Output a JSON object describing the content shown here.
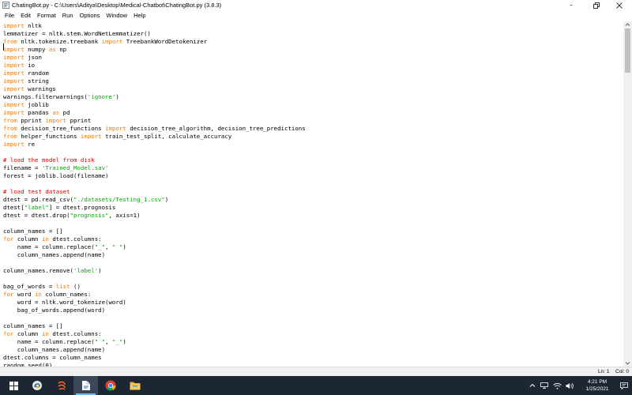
{
  "window": {
    "title": "ChatingBot.py - C:\\Users\\Aditya\\Desktop\\Medical-Chatbot\\ChatingBot.py (3.8.3)",
    "app_icon": "idle-python-icon",
    "minimize_label": "–",
    "controls": [
      "minimize-icon",
      "restore-icon",
      "close-icon"
    ]
  },
  "menu": {
    "items": [
      "File",
      "Edit",
      "Format",
      "Run",
      "Options",
      "Window",
      "Help"
    ]
  },
  "colors": {
    "keyword": "#ff7700",
    "string": "#00aa00",
    "comment": "#dd0000",
    "taskbar": "#1d2733"
  },
  "editor": {
    "lines": [
      [
        [
          "kw",
          "import"
        ],
        [
          "",
          "nltk"
        ]
      ],
      [
        [
          "",
          "lemmatizer = nltk.stem.WordNetLemmatizer()"
        ]
      ],
      [
        [
          "kw",
          "from"
        ],
        [
          "",
          "nltk.tokenize.treebank "
        ],
        [
          "kw",
          "import"
        ],
        [
          "",
          "TreebankWordDetokenizer"
        ]
      ],
      [
        [
          "kw",
          "import"
        ],
        [
          "",
          "numpy "
        ],
        [
          "kw",
          "as"
        ],
        [
          "",
          "np"
        ]
      ],
      [
        [
          "kw",
          "import"
        ],
        [
          "",
          "json"
        ]
      ],
      [
        [
          "kw",
          "import"
        ],
        [
          "",
          "io"
        ]
      ],
      [
        [
          "kw",
          "import"
        ],
        [
          "",
          "random"
        ]
      ],
      [
        [
          "kw",
          "import"
        ],
        [
          "",
          "string"
        ]
      ],
      [
        [
          "kw",
          "import"
        ],
        [
          "",
          "warnings"
        ]
      ],
      [
        [
          "",
          "warnings.filterwarnings("
        ],
        [
          "str",
          "'ignore'"
        ],
        [
          "",
          ")"
        ]
      ],
      [
        [
          "kw",
          "import"
        ],
        [
          "",
          "joblib"
        ]
      ],
      [
        [
          "kw",
          "import"
        ],
        [
          "",
          "pandas "
        ],
        [
          "kw",
          "as"
        ],
        [
          "",
          "pd"
        ]
      ],
      [
        [
          "kw",
          "from"
        ],
        [
          "",
          "pprint "
        ],
        [
          "kw",
          "import"
        ],
        [
          "",
          "pprint"
        ]
      ],
      [
        [
          "kw",
          "from"
        ],
        [
          "",
          "decision_tree_functions "
        ],
        [
          "kw",
          "import"
        ],
        [
          "",
          "decision_tree_algorithm, decision_tree_predictions"
        ]
      ],
      [
        [
          "kw",
          "from"
        ],
        [
          "",
          "helper_functions "
        ],
        [
          "kw",
          "import"
        ],
        [
          "",
          "train_test_split, calculate_accuracy"
        ]
      ],
      [
        [
          "kw",
          "import"
        ],
        [
          "",
          "re"
        ]
      ],
      [],
      [
        [
          "cm",
          "# load the model from disk"
        ]
      ],
      [
        [
          "",
          "filename = "
        ],
        [
          "str",
          "'Trained_Model.sav'"
        ]
      ],
      [
        [
          "",
          "forest = joblib.load(filename)"
        ]
      ],
      [],
      [
        [
          "cm",
          "# load test dataset"
        ]
      ],
      [
        [
          "",
          "dtest = pd.read_csv("
        ],
        [
          "str",
          "\"./datasets/Testing_1.csv\""
        ],
        [
          "",
          ")"
        ]
      ],
      [
        [
          "",
          "dtest["
        ],
        [
          "str",
          "\"label\""
        ],
        [
          "",
          "] = dtest.prognosis"
        ]
      ],
      [
        [
          "",
          "dtest = dtest.drop("
        ],
        [
          "str",
          "\"prognosis\""
        ],
        [
          "",
          ", axis=1)"
        ]
      ],
      [],
      [
        [
          "",
          "column_names = []"
        ]
      ],
      [
        [
          "kw",
          "for"
        ],
        [
          "",
          "column "
        ],
        [
          "kw",
          "in"
        ],
        [
          "",
          "dtest.columns:"
        ]
      ],
      [
        [
          "",
          "    name = column.replace("
        ],
        [
          "str",
          "\"_\""
        ],
        [
          "",
          ", "
        ],
        [
          "str",
          "\" \""
        ],
        [
          "",
          ")"
        ]
      ],
      [
        [
          "",
          "    column_names.append(name)"
        ]
      ],
      [],
      [
        [
          "",
          "column_names.remove("
        ],
        [
          "str",
          "'label'"
        ],
        [
          "",
          ")"
        ]
      ],
      [],
      [
        [
          "",
          "bag_of_words = "
        ],
        [
          "kw",
          "list"
        ],
        [
          "",
          "()"
        ]
      ],
      [
        [
          "kw",
          "for"
        ],
        [
          "",
          "word "
        ],
        [
          "kw",
          "in"
        ],
        [
          "",
          "column_names:"
        ]
      ],
      [
        [
          "",
          "    word = nltk.word_tokenize(word)"
        ]
      ],
      [
        [
          "",
          "    bag_of_words.append(word)"
        ]
      ],
      [],
      [
        [
          "",
          "column_names = []"
        ]
      ],
      [
        [
          "kw",
          "for"
        ],
        [
          "",
          "column "
        ],
        [
          "kw",
          "in"
        ],
        [
          "",
          "dtest.columns:"
        ]
      ],
      [
        [
          "",
          "    name = column.replace("
        ],
        [
          "str",
          "\" \""
        ],
        [
          "",
          ", "
        ],
        [
          "str",
          "\"_\""
        ],
        [
          "",
          ")"
        ]
      ],
      [
        [
          "",
          "    column_names.append(name)"
        ]
      ],
      [
        [
          "",
          "dtest.columns = column_names"
        ]
      ],
      [
        [
          "",
          "random.seed(0)"
        ]
      ]
    ]
  },
  "status": {
    "line": "Ln: 1",
    "col": "Col: 0"
  },
  "taskbar": {
    "apps": [
      "windows-start-icon",
      "idle-python-icon",
      "anaconda-icon",
      "file-icon",
      "chrome-icon",
      "file-explorer-icon"
    ],
    "tray": [
      "chevron-up-icon",
      "network-icon",
      "wifi-icon",
      "volume-icon",
      "notification-icon"
    ],
    "time": "4:21 PM",
    "date": "1/25/2021"
  }
}
